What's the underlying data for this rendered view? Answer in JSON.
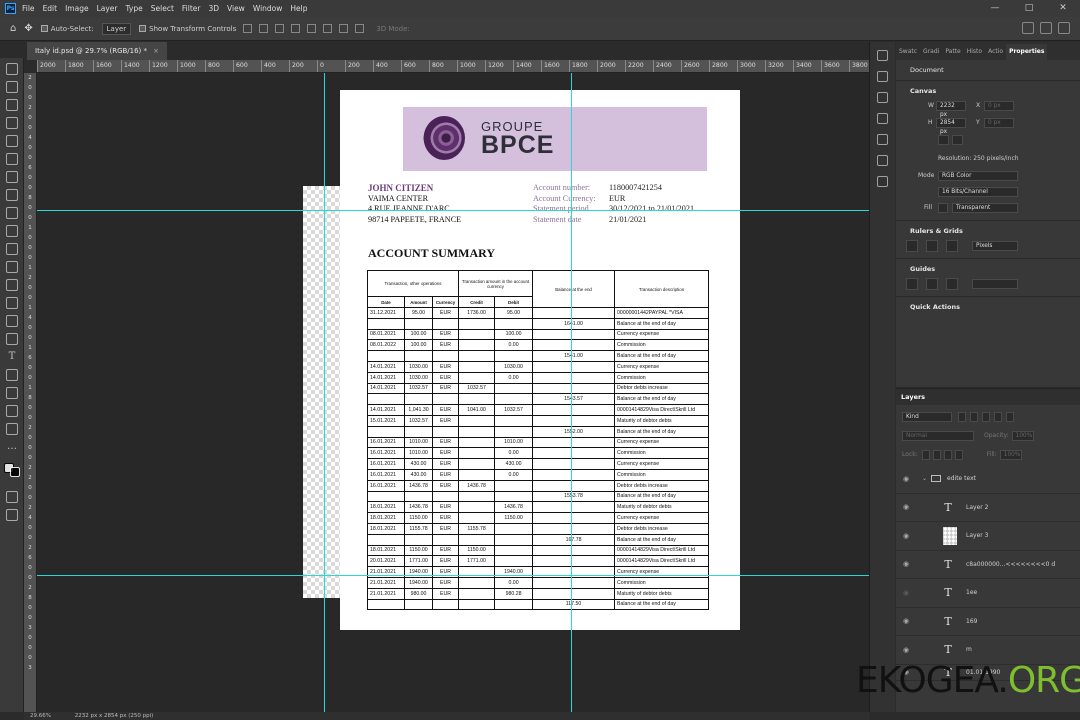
{
  "app": {
    "logo": "Ps",
    "menu": [
      "File",
      "Edit",
      "Image",
      "Layer",
      "Type",
      "Select",
      "Filter",
      "3D",
      "View",
      "Window",
      "Help"
    ],
    "window_buttons": [
      "—",
      "□",
      "✕"
    ]
  },
  "options_bar": {
    "auto_select_label": "Auto-Select:",
    "auto_select_value": "Layer",
    "show_transform_label": "Show Transform Controls",
    "three_d_mode_label": "3D Mode:"
  },
  "document_tab": {
    "title": "Italy id.psd @ 29.7% (RGB/16) *",
    "close": "×"
  },
  "rulers": {
    "top": [
      "2000",
      "1800",
      "1600",
      "1400",
      "1200",
      "1000",
      "800",
      "600",
      "400",
      "200",
      "0",
      "200",
      "400",
      "600",
      "800",
      "1000",
      "1200",
      "1400",
      "1600",
      "1800",
      "2000",
      "2200",
      "2400",
      "2600",
      "2800",
      "3000",
      "3200",
      "3400",
      "3600",
      "3800"
    ],
    "left": [
      "2",
      "0",
      "0",
      "2",
      "0",
      "0",
      "4",
      "0",
      "0",
      "6",
      "0",
      "0",
      "8",
      "0",
      "0",
      "1",
      "0",
      "0",
      "0",
      "1",
      "2",
      "0",
      "0",
      "1",
      "4",
      "0",
      "0",
      "1",
      "6",
      "0",
      "0",
      "1",
      "8",
      "0",
      "0",
      "2",
      "0",
      "0",
      "0",
      "2",
      "2",
      "0",
      "0",
      "2",
      "4",
      "0",
      "0",
      "2",
      "6",
      "0",
      "0",
      "2",
      "8",
      "0",
      "0",
      "3",
      "0",
      "0",
      "0",
      "3"
    ]
  },
  "statement": {
    "bank_line1": "GROUPE",
    "bank_line2": "BPCE",
    "customer": {
      "name": "JOHN CITIZEN",
      "line1": "VAIMA CENTER",
      "line2": "4 RUE JEANNE D'ARC",
      "line3": "98714 PAPEETE, FRANCE"
    },
    "account": [
      {
        "label": "Account number:",
        "value": "1180007421254"
      },
      {
        "label": "Account Currency:",
        "value": "EUR"
      },
      {
        "label": "Statement period",
        "value": "30/12/2021 to 21/01/2021"
      },
      {
        "label": "Statement date",
        "value": "21/01/2021"
      }
    ],
    "summary_title": "ACCOUNT SUMMARY",
    "table_headers": {
      "transaction_group": "Transaction, other operations",
      "amount_group": "Transaction amount in the account currency",
      "balance": "Balance at the end",
      "description": "Transaction description",
      "date": "Date",
      "amount": "Amount",
      "currency": "Currency",
      "credit": "Credit",
      "debit": "Debit"
    },
    "rows": [
      [
        "31.12.2021",
        "95.00",
        "EUR",
        "1736.00",
        "95.00",
        "",
        "00000001442PAYPAL *VISA"
      ],
      [
        "",
        "",
        "",
        "",
        "",
        "1641.00",
        "Balance at the end of day"
      ],
      [
        "08.01.2021",
        "100.00",
        "EUR",
        "",
        "100.00",
        "",
        "Currency expense"
      ],
      [
        "08.01.2022",
        "100.00",
        "EUR",
        "",
        "0.00",
        "",
        "Commission"
      ],
      [
        "",
        "",
        "",
        "",
        "",
        "1541.00",
        "Balance at the end of day"
      ],
      [
        "14.01.2021",
        "1030.00",
        "EUR",
        "",
        "1030.00",
        "",
        "Currency expense"
      ],
      [
        "14.01.2021",
        "1030.00",
        "EUR",
        "",
        "0.00",
        "",
        "Commission"
      ],
      [
        "14.01.2021",
        "1032.57",
        "EUR",
        "1032.57",
        "",
        "",
        "Debtor debts increase"
      ],
      [
        "",
        "",
        "",
        "",
        "",
        "1543.57",
        "Balance at the end of day"
      ],
      [
        "14.01.2021",
        "1,041.30",
        "EUR",
        "1041.00",
        "1032.57",
        "",
        "00001414829Visa Direct\\Skrill Ltd"
      ],
      [
        "15.01.2021",
        "1032.57",
        "EUR",
        "",
        "",
        "",
        "Maturity of debtor debts"
      ],
      [
        "",
        "",
        "",
        "",
        "",
        "1552.00",
        "Balance at the end of day"
      ],
      [
        "16.01.2021",
        "1010.00",
        "EUR",
        "",
        "1010.00",
        "",
        "Currency expense"
      ],
      [
        "16.01.2021",
        "1010.00",
        "EUR",
        "",
        "0.00",
        "",
        "Commission"
      ],
      [
        "16.01.2021",
        "430.00",
        "EUR",
        "",
        "430.00",
        "",
        "Currency expense"
      ],
      [
        "16.01.2021",
        "430.00",
        "EUR",
        "",
        "0.00",
        "",
        "Commission"
      ],
      [
        "16.01.2021",
        "1436.78",
        "EUR",
        "1436.78",
        "",
        "",
        "Debtor debts increase"
      ],
      [
        "",
        "",
        "",
        "",
        "",
        "1553.78",
        "Balance at the end of day"
      ],
      [
        "18.01.2021",
        "1436.78",
        "EUR",
        "",
        "1436.78",
        "",
        "Maturity of debtor debts"
      ],
      [
        "18.01.2021",
        "1150.00",
        "EUR",
        "",
        "1150.00",
        "",
        "Currency expense"
      ],
      [
        "18.01.2021",
        "1155.78",
        "EUR",
        "1155.78",
        "",
        "",
        "Debtor debts increase"
      ],
      [
        "",
        "",
        "",
        "",
        "",
        "167.78",
        "Balance at the end of day"
      ],
      [
        "18.01.2021",
        "1150.00",
        "EUR",
        "1150.00",
        "",
        "",
        "00001414829Visa Direct\\Skrill Ltd"
      ],
      [
        "20.01.2021",
        "1771.00",
        "EUR",
        "1771.00",
        "",
        "",
        "00001414829Visa Direct\\Skrill Ltd"
      ],
      [
        "21.01.2021",
        "1940.00",
        "EUR",
        "",
        "1940.00",
        "",
        "Currency expense"
      ],
      [
        "21.01.2021",
        "1940.00",
        "EUR",
        "",
        "0.00",
        "",
        "Commission"
      ],
      [
        "21.01.2021",
        "980.00",
        "EUR",
        "",
        "980.28",
        "",
        "Maturity of debtor debts"
      ],
      [
        "",
        "",
        "",
        "",
        "",
        "117.50",
        "Balance at the end of day"
      ]
    ]
  },
  "panels": {
    "tabs": [
      "Swatc",
      "Gradi",
      "Patte",
      "Histo",
      "Actio",
      "Properties"
    ],
    "properties": {
      "doc_label": "Document",
      "canvas_title": "Canvas",
      "w_label": "W",
      "w_value": "2232 px",
      "h_label": "H",
      "h_value": "2854 px",
      "x_label": "X",
      "x_value": "0 px",
      "y_label": "Y",
      "y_value": "0 px",
      "resolution": "Resolution: 250 pixels/inch",
      "mode_label": "Mode",
      "mode_value": "RGB Color",
      "depth_value": "16 Bits/Channel",
      "fill_label": "Fill",
      "fill_value": "Transparent",
      "rulers_title": "Rulers & Grids",
      "units_value": "Pixels",
      "guides_title": "Guides",
      "quick_actions_title": "Quick Actions"
    },
    "layers": {
      "title": "Layers",
      "kind_label": "Kind",
      "blend_value": "Normal",
      "opacity_label": "Opacity:",
      "opacity_value": "100%",
      "lock_label": "Lock:",
      "fill_label": "Fill:",
      "fill_value": "100%",
      "items": [
        {
          "name": "edite text",
          "type": "group"
        },
        {
          "name": "Layer 2",
          "type": "text"
        },
        {
          "name": "Layer 3",
          "type": "image"
        },
        {
          "name": "c8a000000...<<<<<<<<0 d",
          "type": "text"
        },
        {
          "name": "1ee",
          "type": "text"
        },
        {
          "name": "169",
          "type": "text"
        },
        {
          "name": "m",
          "type": "text"
        },
        {
          "name": "01.01.1990",
          "type": "text"
        }
      ]
    }
  },
  "status_bar": {
    "zoom": "29.66%",
    "doc_size": "2232 px x 2854 px (250 ppi)"
  },
  "watermark": {
    "part1": "EKOGEA.",
    "part2": "ORG"
  }
}
